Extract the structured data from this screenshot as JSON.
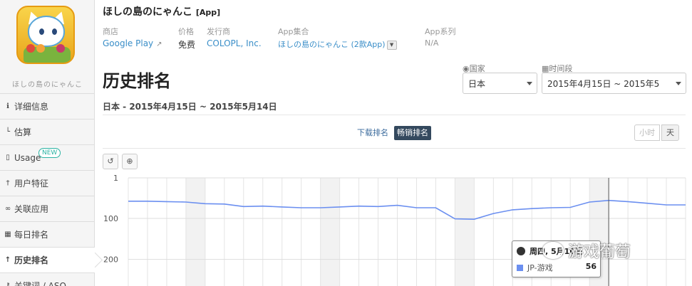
{
  "sidebar": {
    "app_name": "ほしの島のにゃんこ",
    "items": [
      {
        "label": "详细信息",
        "icon": "info-icon"
      },
      {
        "label": "估算",
        "icon": "chart-icon"
      },
      {
        "label": "Usage",
        "icon": "phone-icon",
        "badge": "NEW"
      },
      {
        "label": "用户特征",
        "icon": "user-icon"
      },
      {
        "label": "关联应用",
        "icon": "link-icon"
      },
      {
        "label": "每日排名",
        "icon": "calendar-icon"
      },
      {
        "label": "历史排名",
        "icon": "arrow-up-icon"
      },
      {
        "label": "关键词 / ASO",
        "icon": "key-icon"
      }
    ]
  },
  "header": {
    "title": "ほしの島のにゃんこ",
    "tag": "[App]",
    "meta": {
      "store_label": "商店",
      "store_value": "Google Play",
      "price_label": "价格",
      "price_value": "免费",
      "publisher_label": "发行商",
      "publisher_value": "COLOPL, Inc.",
      "collection_label": "App集合",
      "collection_value": "ほしの島のにゃんこ (2款App)",
      "series_label": "App系列",
      "series_value": "N/A"
    }
  },
  "filters": {
    "country_label": "国家",
    "country_value": "日本",
    "period_label": "时间段",
    "period_value": "2015年4月15日 ~ 2015年5"
  },
  "main": {
    "title": "历史排名",
    "subtitle": "日本 - 2015年4月15日 ~ 2015年5月14日",
    "tabs": [
      {
        "label": "下载排名",
        "active": false
      },
      {
        "label": "畅销排名",
        "active": true
      }
    ],
    "granularity": [
      {
        "label": "小时",
        "active": false
      },
      {
        "label": "天",
        "active": true
      }
    ]
  },
  "tooltip": {
    "title": "周四, 5月10日",
    "series_name": "JP-游戏",
    "value": "56"
  },
  "watermark": "游戏葡萄",
  "colors": {
    "series": "#6b8ff0",
    "accent": "#3a8ec8",
    "active_tab": "#34495e"
  },
  "chart_data": {
    "type": "line",
    "y_axis": {
      "reversed": true,
      "ticks": [
        1,
        100,
        200
      ]
    },
    "series": [
      {
        "name": "JP-游戏",
        "values": [
          58,
          58,
          59,
          60,
          64,
          65,
          71,
          70,
          72,
          74,
          74,
          72,
          70,
          71,
          68,
          74,
          74,
          101,
          102,
          88,
          79,
          76,
          74,
          73,
          60,
          56,
          59,
          63,
          67,
          67
        ]
      }
    ]
  }
}
